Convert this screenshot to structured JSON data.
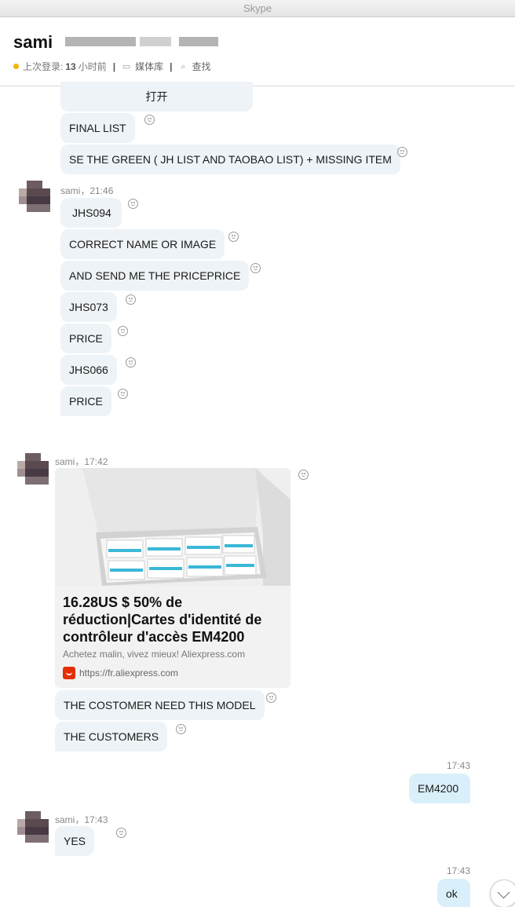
{
  "window": {
    "title": "Skype"
  },
  "header": {
    "contact_name": "sami",
    "last_login_label": "上次登录:",
    "last_login_value": "13",
    "last_login_unit": "小时前",
    "media_label": "媒体库",
    "find_label": "查找"
  },
  "messages": {
    "open_button": "打开",
    "final_list": "FINAL LIST",
    "see_green": "SE THE GREEN ( JH LIST AND TAOBAO LIST) + MISSING ITEM",
    "group2_meta": "sami，21:46",
    "g2": [
      "JHS094",
      "CORRECT NAME OR IMAGE",
      "AND SEND ME THE PRICEPRICE",
      "JHS073",
      "PRICE",
      "JHS066",
      "PRICE"
    ],
    "group3_meta": "sami，17:42",
    "card": {
      "title": "16.28US $ 50% de réduction|Cartes d'identité de contrôleur d'accès EM4200",
      "desc": "Achetez malin, vivez mieux! Aliexpress.com",
      "source": "https://fr.aliexpress.com"
    },
    "g3": [
      "THE COSTOMER NEED THIS MODEL",
      "THE CUSTOMERS"
    ],
    "out1_time": "17:43",
    "out1_text": "EM4200",
    "group4_meta": "sami，17:43",
    "g4": [
      "YES"
    ],
    "out2_time": "17:43",
    "out2_text": "ok"
  },
  "colors": {
    "incoming_bubble": "#eef3f7",
    "outgoing_bubble": "#d9f0fb",
    "presence_away": "#f3b400"
  }
}
